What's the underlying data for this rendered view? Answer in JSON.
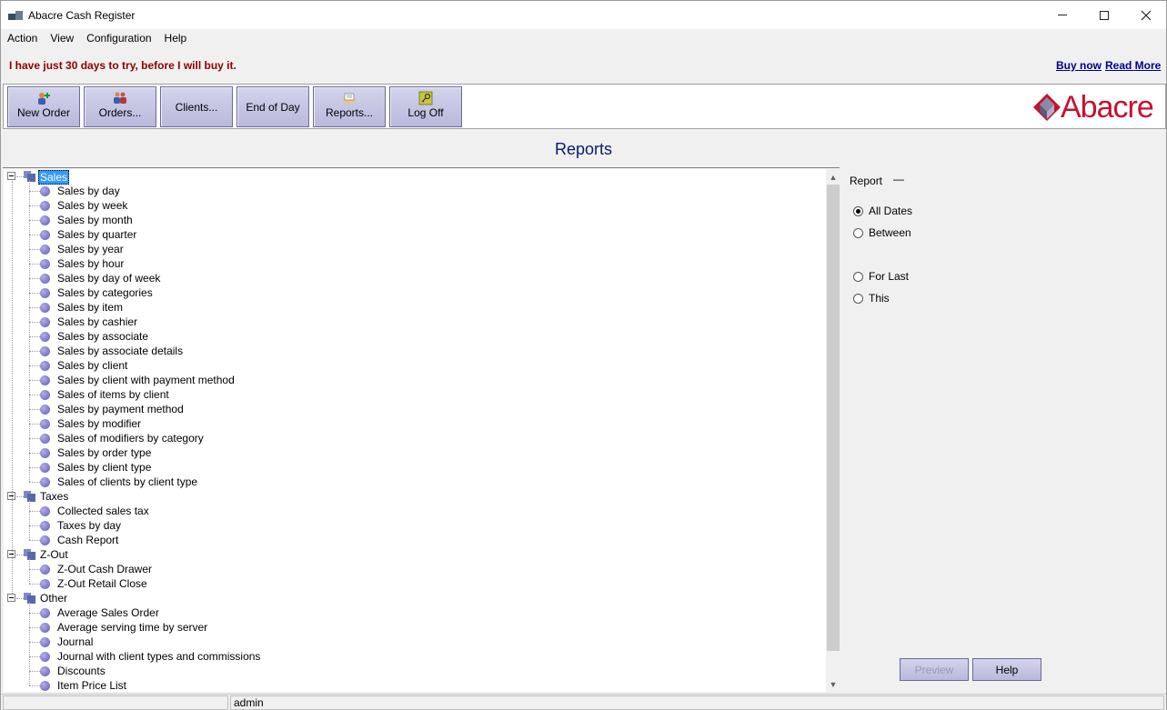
{
  "window": {
    "title": "Abacre Cash Register",
    "controls": {
      "minimize": "minimize-icon",
      "maximize": "maximize-icon",
      "close": "close-icon"
    }
  },
  "menu": [
    "Action",
    "View",
    "Configuration",
    "Help"
  ],
  "notice": {
    "trial_text": "I have just 30 days to try, before I will buy it.",
    "buy_now": "Buy now",
    "read_more": "Read More"
  },
  "toolbar": {
    "buttons": [
      {
        "label": "New Order",
        "icon": "new-order-icon"
      },
      {
        "label": "Orders...",
        "icon": "orders-icon"
      },
      {
        "label": "Clients...",
        "icon": ""
      },
      {
        "label": "End of Day",
        "icon": ""
      },
      {
        "label": "Reports...",
        "icon": "reports-icon"
      },
      {
        "label": "Log Off",
        "icon": "key-icon"
      }
    ],
    "logo_text": "Abacre"
  },
  "page_title": "Reports",
  "tree": [
    {
      "label": "Sales",
      "selected": true,
      "children": [
        "Sales by day",
        "Sales by week",
        "Sales by month",
        "Sales by quarter",
        "Sales by year",
        "Sales by hour",
        "Sales by day of week",
        "Sales by categories",
        "Sales by item",
        "Sales by cashier",
        "Sales by associate",
        "Sales by associate details",
        "Sales by client",
        "Sales by client with payment method",
        "Sales of items by client",
        "Sales by payment method",
        "Sales by modifier",
        "Sales of modifiers by category",
        "Sales by order type",
        "Sales by client type",
        "Sales of clients by client type"
      ]
    },
    {
      "label": "Taxes",
      "selected": false,
      "children": [
        "Collected sales tax",
        "Taxes by day",
        "Cash Report"
      ]
    },
    {
      "label": "Z-Out",
      "selected": false,
      "children": [
        "Z-Out Cash Drawer",
        "Z-Out Retail Close"
      ]
    },
    {
      "label": "Other",
      "selected": false,
      "children": [
        "Average Sales Order",
        "Average serving time by server",
        "Journal",
        "Journal with client types and commissions",
        "Discounts",
        "Item Price List"
      ]
    }
  ],
  "options": {
    "report_label": "Report",
    "report_value": "—",
    "date_options": [
      {
        "label": "All Dates",
        "checked": true
      },
      {
        "label": "Between",
        "checked": false
      },
      {
        "label": "For Last",
        "checked": false
      },
      {
        "label": "This",
        "checked": false
      }
    ],
    "preview_button": "Preview",
    "help_button": "Help"
  },
  "status": {
    "user": "admin"
  },
  "colors": {
    "accent_blue": "#0a1a6a",
    "trial_red": "#8b0000",
    "link_blue": "#00008b",
    "logo_red": "#c8102e",
    "button_face": "#c4c4e4",
    "selection": "#3399ff"
  }
}
